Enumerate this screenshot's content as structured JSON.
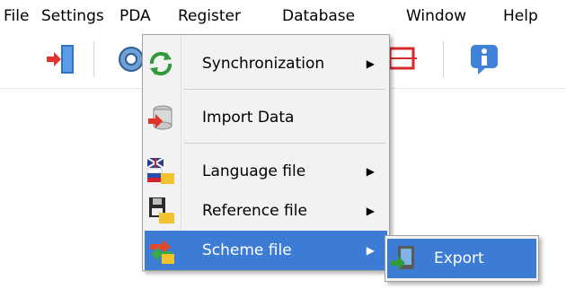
{
  "menubar": {
    "items": [
      "File",
      "Settings",
      "PDA",
      "Register",
      "Database",
      "Window",
      "Help"
    ]
  },
  "toolbar": {
    "buttons": [
      "exit-door-icon",
      "gear-icon",
      "red-frame-icon",
      "info-icon"
    ]
  },
  "pda_menu": {
    "items": [
      {
        "label": "Synchronization",
        "icon": "sync-arrows-icon",
        "has_submenu": true
      },
      {
        "label": "Import Data",
        "icon": "database-import-icon",
        "has_submenu": false
      },
      {
        "label": "Language file",
        "icon": "flags-folder-icon",
        "has_submenu": true
      },
      {
        "label": "Reference file",
        "icon": "floppy-folder-icon",
        "has_submenu": true
      },
      {
        "label": "Scheme file",
        "icon": "scheme-arrows-folder-icon",
        "has_submenu": true,
        "selected": true
      }
    ],
    "submenu_arrow": "▶"
  },
  "scheme_submenu": {
    "items": [
      {
        "label": "Export",
        "icon": "export-device-icon",
        "selected": true
      }
    ]
  },
  "colors": {
    "selection": "#3d7cd4",
    "menu_bg": "#f2f2f2"
  }
}
